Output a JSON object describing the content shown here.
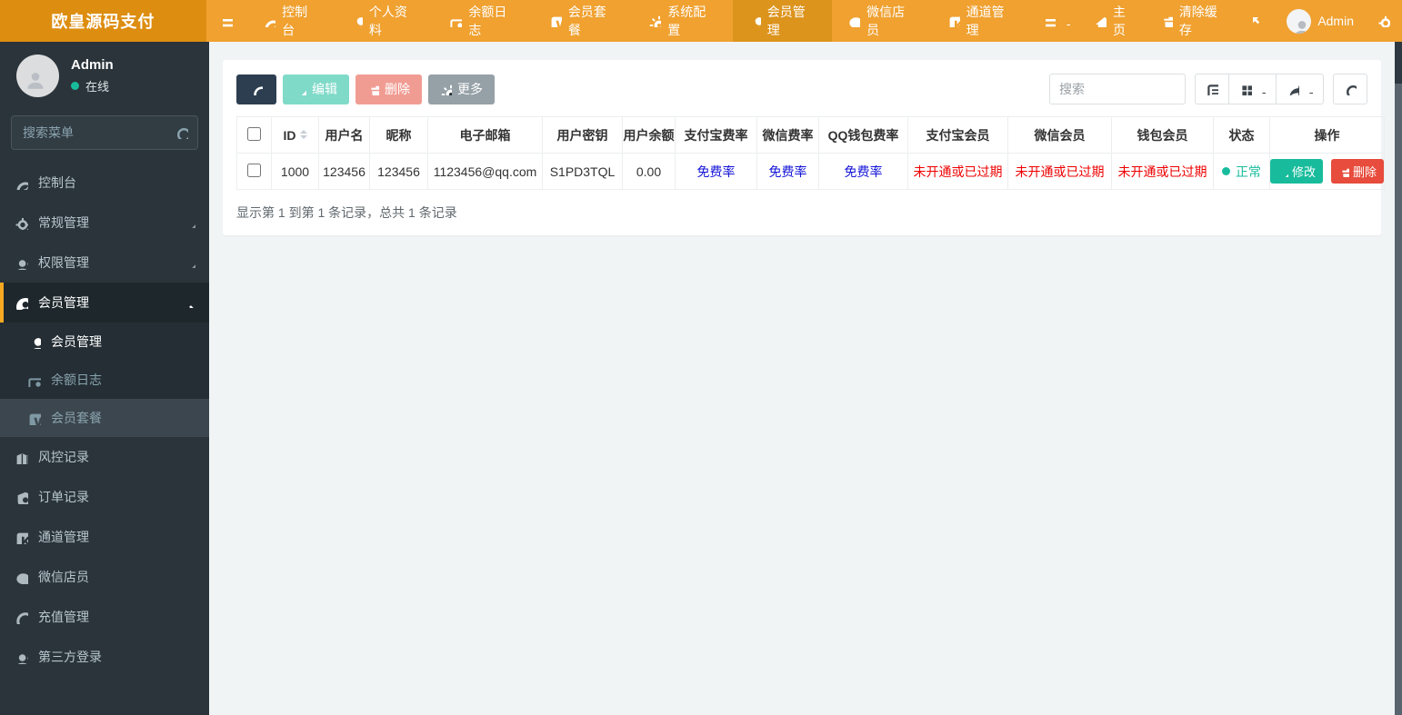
{
  "navbar": {
    "brand": "欧皇源码支付",
    "items": [
      {
        "label": "控制台",
        "icon": "tachometer-icon"
      },
      {
        "label": "个人资料",
        "icon": "user-icon"
      },
      {
        "label": "余额日志",
        "icon": "money-icon"
      },
      {
        "label": "会员套餐",
        "icon": "v-square-icon"
      },
      {
        "label": "系统配置",
        "icon": "gear-icon"
      },
      {
        "label": "会员管理",
        "icon": "user-icon",
        "active": true
      },
      {
        "label": "微信店员",
        "icon": "wechat-icon"
      },
      {
        "label": "通道管理",
        "icon": "k-square-icon"
      }
    ],
    "home_label": "主页",
    "clear_cache_label": "清除缓存",
    "admin_label": "Admin"
  },
  "sidebar": {
    "user_name": "Admin",
    "user_status": "在线",
    "search_placeholder": "搜索菜单",
    "items": [
      {
        "label": "控制台"
      },
      {
        "label": "常规管理"
      },
      {
        "label": "权限管理"
      },
      {
        "label": "会员管理"
      },
      {
        "label": "风控记录"
      },
      {
        "label": "订单记录"
      },
      {
        "label": "通道管理"
      },
      {
        "label": "微信店员"
      },
      {
        "label": "充值管理"
      },
      {
        "label": "第三方登录"
      }
    ],
    "submenu": [
      {
        "label": "会员管理"
      },
      {
        "label": "余额日志"
      },
      {
        "label": "会员套餐"
      }
    ]
  },
  "toolbar": {
    "edit_label": "编辑",
    "delete_label": "删除",
    "more_label": "更多",
    "search_placeholder": "搜索"
  },
  "table": {
    "headers": [
      "ID",
      "用户名",
      "昵称",
      "电子邮箱",
      "用户密钥",
      "用户余额",
      "支付宝费率",
      "微信费率",
      "QQ钱包费率",
      "支付宝会员",
      "微信会员",
      "钱包会员",
      "状态",
      "操作"
    ],
    "row": {
      "id": "1000",
      "username": "123456",
      "nickname": "123456",
      "email": "1123456@qq.com",
      "secret": "S1PD3TQL",
      "balance": "0.00",
      "alipay_rate": "免费率",
      "wechat_rate": "免费率",
      "qq_rate": "免费率",
      "alipay_vip": "未开通或已过期",
      "wechat_vip": "未开通或已过期",
      "wallet_vip": "未开通或已过期",
      "status": "正常",
      "edit_label": "修改",
      "delete_label": "删除"
    }
  },
  "footer_text": "显示第 1 到第 1 条记录，总共 1 条记录",
  "colors": {
    "navbar_orange": "#f0a130",
    "brand_orange": "#dd8d10",
    "active_orange": "#dd941d",
    "sidebar_dark": "#2a343a",
    "success_green": "#18bc9c",
    "danger_red": "#e74c3c",
    "link_blue": "#1414d8",
    "alert_red": "#ee0000",
    "dark_button": "#2c3e50"
  }
}
